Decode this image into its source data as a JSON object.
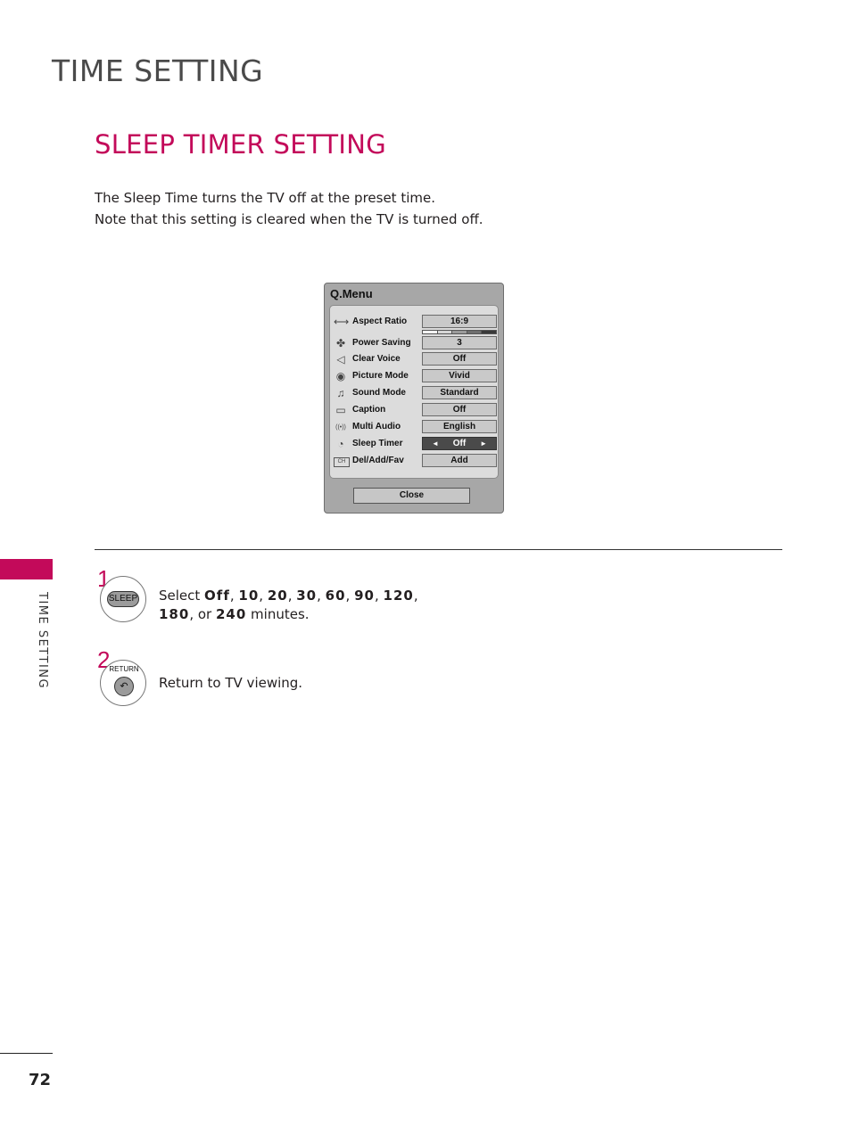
{
  "header": {
    "title": "TIME SETTING"
  },
  "section": {
    "title": "SLEEP TIMER SETTING",
    "intro": [
      "The Sleep Time turns the TV off at the preset time.",
      "Note that this setting is cleared when the TV is turned off."
    ]
  },
  "qmenu": {
    "title": "Q.Menu",
    "power_saving_level": 3,
    "power_saving_levels_total": 5,
    "items": [
      {
        "icon": "aspect-ratio-icon",
        "glyph": "⟷",
        "label": "Aspect Ratio",
        "value": "16:9"
      },
      {
        "icon": "power-saving-icon",
        "glyph": "✤",
        "label": "Power Saving",
        "value": "3"
      },
      {
        "icon": "clear-voice-icon",
        "glyph": "◁",
        "label": "Clear Voice",
        "value": "Off"
      },
      {
        "icon": "picture-mode-icon",
        "glyph": "◉",
        "label": "Picture Mode",
        "value": "Vivid"
      },
      {
        "icon": "sound-mode-icon",
        "glyph": "♫",
        "label": "Sound Mode",
        "value": "Standard"
      },
      {
        "icon": "caption-icon",
        "glyph": "▭",
        "label": "Caption",
        "value": "Off"
      },
      {
        "icon": "multi-audio-icon",
        "glyph": "((•))",
        "label": "Multi Audio",
        "value": "English"
      },
      {
        "icon": "sleep-timer-icon",
        "glyph": "◔",
        "label": "Sleep Timer",
        "value": "Off",
        "selected": true
      },
      {
        "icon": "channel-fav-icon",
        "glyph": "CH",
        "label": "Del/Add/Fav",
        "value": "Add"
      }
    ],
    "arrow_left": "◄",
    "arrow_right": "►",
    "close_label": "Close"
  },
  "side_tab": {
    "label": "TIME SETTING",
    "color": "#c30a5a"
  },
  "steps": [
    {
      "number": "1",
      "key_label": "SLEEP",
      "text_prefix": "Select ",
      "options": [
        "Off",
        "10",
        "20",
        "30",
        "60",
        "90",
        "120",
        "180",
        "240"
      ],
      "text_or": ", or ",
      "text_suffix": " minutes."
    },
    {
      "number": "2",
      "key_label": "RETURN",
      "key_glyph": "↶",
      "text": "Return to TV viewing."
    }
  ],
  "footer": {
    "page_number": "72"
  },
  "colors": {
    "accent": "#c30a5a",
    "heading_gray": "#4a4a4a"
  }
}
